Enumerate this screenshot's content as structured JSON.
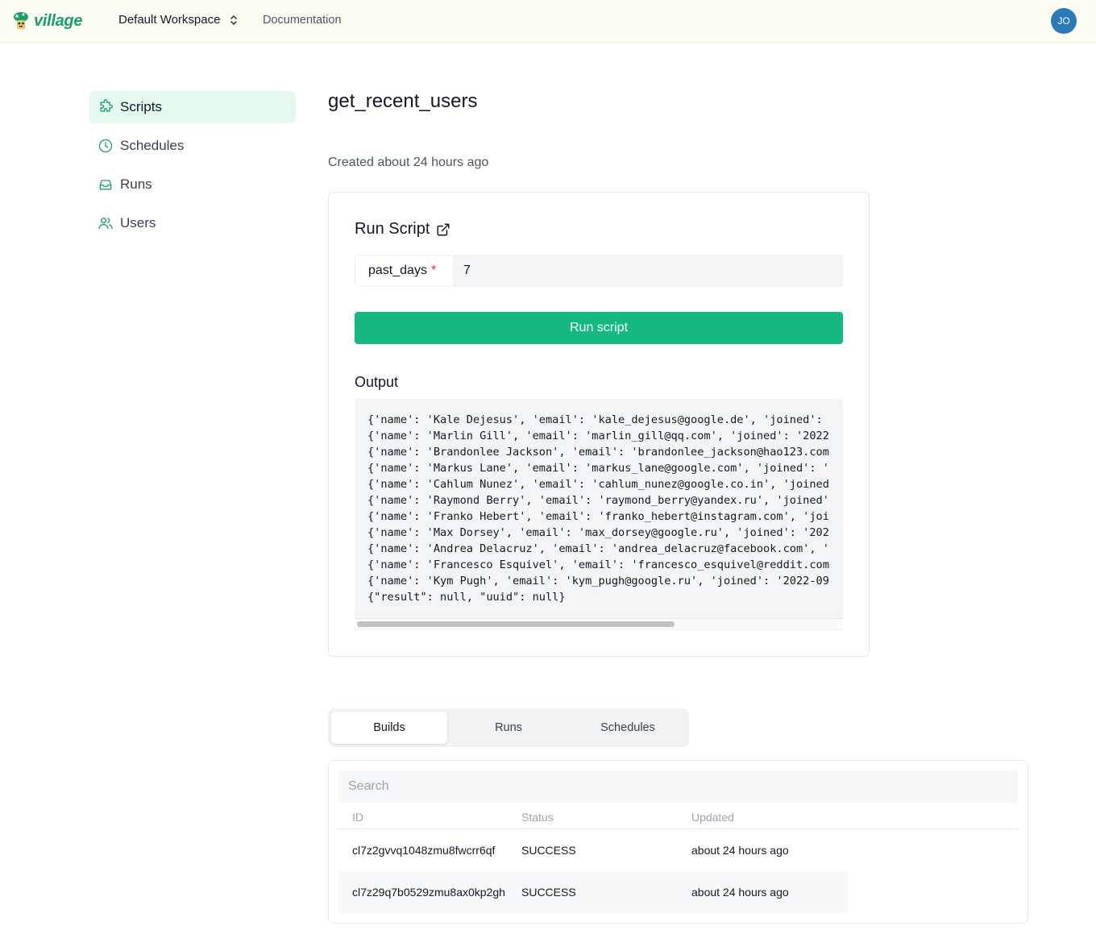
{
  "header": {
    "brand": "village",
    "workspace": "Default Workspace",
    "documentation_link": "Documentation",
    "avatar_initials": "JO"
  },
  "sidebar": {
    "items": [
      {
        "label": "Scripts",
        "icon": "puzzle-icon",
        "active": true
      },
      {
        "label": "Schedules",
        "icon": "clock-icon",
        "active": false
      },
      {
        "label": "Runs",
        "icon": "inbox-icon",
        "active": false
      },
      {
        "label": "Users",
        "icon": "users-icon",
        "active": false
      }
    ]
  },
  "main": {
    "title": "get_recent_users",
    "created": "Created about 24 hours ago"
  },
  "run_card": {
    "title": "Run Script",
    "param_name": "past_days",
    "param_required_marker": "*",
    "param_value": "7",
    "run_button": "Run script",
    "output_label": "Output",
    "output_lines": [
      "{'name': 'Kale Dejesus', 'email': 'kale_dejesus@google.de', 'joined': ",
      "{'name': 'Marlin Gill', 'email': 'marlin_gill@qq.com', 'joined': '2022",
      "{'name': 'Brandonlee Jackson', 'email': 'brandonlee_jackson@hao123.com",
      "{'name': 'Markus Lane', 'email': 'markus_lane@google.com', 'joined': '",
      "{'name': 'Cahlum Nunez', 'email': 'cahlum_nunez@google.co.in', 'joined",
      "{'name': 'Raymond Berry', 'email': 'raymond_berry@yandex.ru', 'joined'",
      "{'name': 'Franko Hebert', 'email': 'franko_hebert@instagram.com', 'joi",
      "{'name': 'Max Dorsey', 'email': 'max_dorsey@google.ru', 'joined': '202",
      "{'name': 'Andrea Delacruz', 'email': 'andrea_delacruz@facebook.com', '",
      "{'name': 'Francesco Esquivel', 'email': 'francesco_esquivel@reddit.com",
      "{'name': 'Kym Pugh', 'email': 'kym_pugh@google.ru', 'joined': '2022-09",
      "{\"result\": null, \"uuid\": null}"
    ]
  },
  "tabs": [
    {
      "label": "Builds",
      "active": true
    },
    {
      "label": "Runs",
      "active": false
    },
    {
      "label": "Schedules",
      "active": false
    }
  ],
  "builds": {
    "search_placeholder": "Search",
    "columns": [
      "ID",
      "Status",
      "Updated"
    ],
    "rows": [
      {
        "id": "cl7z2gvvq1048zmu8fwcrr6qf",
        "status": "SUCCESS",
        "updated": "about 24 hours ago"
      },
      {
        "id": "cl7z29q7b0529zmu8ax0kp2gh",
        "status": "SUCCESS",
        "updated": "about 24 hours ago"
      }
    ]
  },
  "colors": {
    "brand_green": "#17a06a",
    "button_green": "#15b882",
    "active_nav_bg": "#e6f9ee",
    "avatar_blue": "#2b7ab8",
    "required_red": "#e03131"
  }
}
